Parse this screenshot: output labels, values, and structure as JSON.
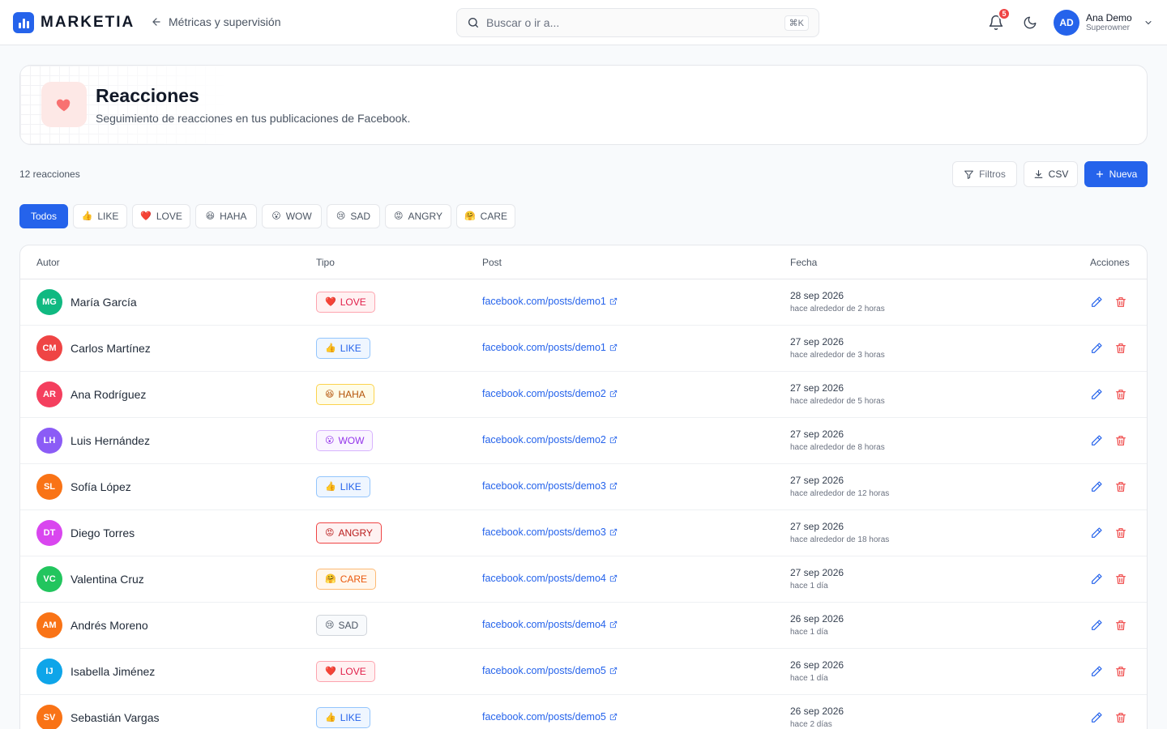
{
  "brand": {
    "name": "MARKETIA"
  },
  "nav": {
    "back_label": "Métricas y supervisión"
  },
  "search": {
    "placeholder": "Buscar o ir a...",
    "shortcut": "⌘K"
  },
  "notifications": {
    "count": "5"
  },
  "user": {
    "initials": "AD",
    "name": "Ana Demo",
    "role": "Superowner"
  },
  "header": {
    "title": "Reacciones",
    "subtitle": "Seguimiento de reacciones en tus publicaciones de Facebook."
  },
  "toolbar": {
    "count_label": "12 reacciones",
    "filters_label": "Filtros",
    "csv_label": "CSV",
    "new_label": "Nueva"
  },
  "filters": [
    {
      "label": "Todos",
      "emoji": "",
      "active": true
    },
    {
      "label": "LIKE",
      "emoji": "👍"
    },
    {
      "label": "LOVE",
      "emoji": "❤️"
    },
    {
      "label": "HAHA",
      "emoji": "😆"
    },
    {
      "label": "WOW",
      "emoji": "😮"
    },
    {
      "label": "SAD",
      "emoji": "😢"
    },
    {
      "label": "ANGRY",
      "emoji": "😡"
    },
    {
      "label": "CARE",
      "emoji": "🤗"
    }
  ],
  "table": {
    "columns": [
      "Autor",
      "Tipo",
      "Post",
      "Fecha",
      "Acciones"
    ],
    "rows": [
      {
        "initials": "MG",
        "author": "María García",
        "type": "LOVE",
        "emoji": "❤️",
        "post": "facebook.com/posts/demo1",
        "date": "28 sep 2026",
        "relative": "hace alrededor de 2 horas",
        "avatar_color": "#10b981"
      },
      {
        "initials": "CM",
        "author": "Carlos Martínez",
        "type": "LIKE",
        "emoji": "👍",
        "post": "facebook.com/posts/demo1",
        "date": "27 sep 2026",
        "relative": "hace alrededor de 3 horas",
        "avatar_color": "#ef4444"
      },
      {
        "initials": "AR",
        "author": "Ana Rodríguez",
        "type": "HAHA",
        "emoji": "😆",
        "post": "facebook.com/posts/demo2",
        "date": "27 sep 2026",
        "relative": "hace alrededor de 5 horas",
        "avatar_color": "#f43f5e"
      },
      {
        "initials": "LH",
        "author": "Luis Hernández",
        "type": "WOW",
        "emoji": "😮",
        "post": "facebook.com/posts/demo2",
        "date": "27 sep 2026",
        "relative": "hace alrededor de 8 horas",
        "avatar_color": "#8b5cf6"
      },
      {
        "initials": "SL",
        "author": "Sofía López",
        "type": "LIKE",
        "emoji": "👍",
        "post": "facebook.com/posts/demo3",
        "date": "27 sep 2026",
        "relative": "hace alrededor de 12 horas",
        "avatar_color": "#f97316"
      },
      {
        "initials": "DT",
        "author": "Diego Torres",
        "type": "ANGRY",
        "emoji": "😡",
        "post": "facebook.com/posts/demo3",
        "date": "27 sep 2026",
        "relative": "hace alrededor de 18 horas",
        "avatar_color": "#d946ef"
      },
      {
        "initials": "VC",
        "author": "Valentina Cruz",
        "type": "CARE",
        "emoji": "🤗",
        "post": "facebook.com/posts/demo4",
        "date": "27 sep 2026",
        "relative": "hace 1 día",
        "avatar_color": "#22c55e"
      },
      {
        "initials": "AM",
        "author": "Andrés Moreno",
        "type": "SAD",
        "emoji": "😢",
        "post": "facebook.com/posts/demo4",
        "date": "26 sep 2026",
        "relative": "hace 1 día",
        "avatar_color": "#f97316"
      },
      {
        "initials": "IJ",
        "author": "Isabella Jiménez",
        "type": "LOVE",
        "emoji": "❤️",
        "post": "facebook.com/posts/demo5",
        "date": "26 sep 2026",
        "relative": "hace 1 día",
        "avatar_color": "#0ea5e9"
      },
      {
        "initials": "SV",
        "author": "Sebastián Vargas",
        "type": "LIKE",
        "emoji": "👍",
        "post": "facebook.com/posts/demo5",
        "date": "26 sep 2026",
        "relative": "hace 2 días",
        "avatar_color": "#f97316"
      }
    ]
  },
  "badge_styles": {
    "LOVE": {
      "bg": "#fff1f2",
      "border": "#fda4af",
      "color": "#e11d48"
    },
    "LIKE": {
      "bg": "#eff6ff",
      "border": "#93c5fd",
      "color": "#2563eb"
    },
    "HAHA": {
      "bg": "#fefce8",
      "border": "#fcd34d",
      "color": "#b45309"
    },
    "WOW": {
      "bg": "#faf5ff",
      "border": "#d8b4fe",
      "color": "#9333ea"
    },
    "ANGRY": {
      "bg": "#fef2f2",
      "border": "#ef4444",
      "color": "#b91c1c"
    },
    "CARE": {
      "bg": "#fff7ed",
      "border": "#fdba74",
      "color": "#ea580c"
    },
    "SAD": {
      "bg": "#f8fafc",
      "border": "#d1d5db",
      "color": "#4b5563"
    }
  },
  "colors": {
    "primary": "#2563eb",
    "heart": "#f43f5e",
    "danger": "#ef4444"
  }
}
